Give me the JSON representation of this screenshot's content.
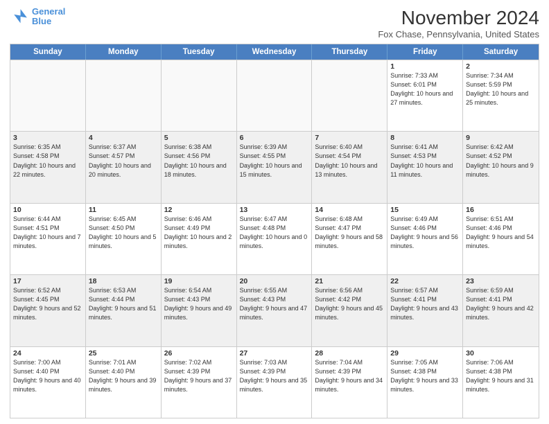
{
  "logo": {
    "line1": "General",
    "line2": "Blue"
  },
  "title": "November 2024",
  "location": "Fox Chase, Pennsylvania, United States",
  "header_days": [
    "Sunday",
    "Monday",
    "Tuesday",
    "Wednesday",
    "Thursday",
    "Friday",
    "Saturday"
  ],
  "rows": [
    [
      {
        "day": "",
        "info": ""
      },
      {
        "day": "",
        "info": ""
      },
      {
        "day": "",
        "info": ""
      },
      {
        "day": "",
        "info": ""
      },
      {
        "day": "",
        "info": ""
      },
      {
        "day": "1",
        "info": "Sunrise: 7:33 AM\nSunset: 6:01 PM\nDaylight: 10 hours and 27 minutes."
      },
      {
        "day": "2",
        "info": "Sunrise: 7:34 AM\nSunset: 5:59 PM\nDaylight: 10 hours and 25 minutes."
      }
    ],
    [
      {
        "day": "3",
        "info": "Sunrise: 6:35 AM\nSunset: 4:58 PM\nDaylight: 10 hours and 22 minutes."
      },
      {
        "day": "4",
        "info": "Sunrise: 6:37 AM\nSunset: 4:57 PM\nDaylight: 10 hours and 20 minutes."
      },
      {
        "day": "5",
        "info": "Sunrise: 6:38 AM\nSunset: 4:56 PM\nDaylight: 10 hours and 18 minutes."
      },
      {
        "day": "6",
        "info": "Sunrise: 6:39 AM\nSunset: 4:55 PM\nDaylight: 10 hours and 15 minutes."
      },
      {
        "day": "7",
        "info": "Sunrise: 6:40 AM\nSunset: 4:54 PM\nDaylight: 10 hours and 13 minutes."
      },
      {
        "day": "8",
        "info": "Sunrise: 6:41 AM\nSunset: 4:53 PM\nDaylight: 10 hours and 11 minutes."
      },
      {
        "day": "9",
        "info": "Sunrise: 6:42 AM\nSunset: 4:52 PM\nDaylight: 10 hours and 9 minutes."
      }
    ],
    [
      {
        "day": "10",
        "info": "Sunrise: 6:44 AM\nSunset: 4:51 PM\nDaylight: 10 hours and 7 minutes."
      },
      {
        "day": "11",
        "info": "Sunrise: 6:45 AM\nSunset: 4:50 PM\nDaylight: 10 hours and 5 minutes."
      },
      {
        "day": "12",
        "info": "Sunrise: 6:46 AM\nSunset: 4:49 PM\nDaylight: 10 hours and 2 minutes."
      },
      {
        "day": "13",
        "info": "Sunrise: 6:47 AM\nSunset: 4:48 PM\nDaylight: 10 hours and 0 minutes."
      },
      {
        "day": "14",
        "info": "Sunrise: 6:48 AM\nSunset: 4:47 PM\nDaylight: 9 hours and 58 minutes."
      },
      {
        "day": "15",
        "info": "Sunrise: 6:49 AM\nSunset: 4:46 PM\nDaylight: 9 hours and 56 minutes."
      },
      {
        "day": "16",
        "info": "Sunrise: 6:51 AM\nSunset: 4:46 PM\nDaylight: 9 hours and 54 minutes."
      }
    ],
    [
      {
        "day": "17",
        "info": "Sunrise: 6:52 AM\nSunset: 4:45 PM\nDaylight: 9 hours and 52 minutes."
      },
      {
        "day": "18",
        "info": "Sunrise: 6:53 AM\nSunset: 4:44 PM\nDaylight: 9 hours and 51 minutes."
      },
      {
        "day": "19",
        "info": "Sunrise: 6:54 AM\nSunset: 4:43 PM\nDaylight: 9 hours and 49 minutes."
      },
      {
        "day": "20",
        "info": "Sunrise: 6:55 AM\nSunset: 4:43 PM\nDaylight: 9 hours and 47 minutes."
      },
      {
        "day": "21",
        "info": "Sunrise: 6:56 AM\nSunset: 4:42 PM\nDaylight: 9 hours and 45 minutes."
      },
      {
        "day": "22",
        "info": "Sunrise: 6:57 AM\nSunset: 4:41 PM\nDaylight: 9 hours and 43 minutes."
      },
      {
        "day": "23",
        "info": "Sunrise: 6:59 AM\nSunset: 4:41 PM\nDaylight: 9 hours and 42 minutes."
      }
    ],
    [
      {
        "day": "24",
        "info": "Sunrise: 7:00 AM\nSunset: 4:40 PM\nDaylight: 9 hours and 40 minutes."
      },
      {
        "day": "25",
        "info": "Sunrise: 7:01 AM\nSunset: 4:40 PM\nDaylight: 9 hours and 39 minutes."
      },
      {
        "day": "26",
        "info": "Sunrise: 7:02 AM\nSunset: 4:39 PM\nDaylight: 9 hours and 37 minutes."
      },
      {
        "day": "27",
        "info": "Sunrise: 7:03 AM\nSunset: 4:39 PM\nDaylight: 9 hours and 35 minutes."
      },
      {
        "day": "28",
        "info": "Sunrise: 7:04 AM\nSunset: 4:39 PM\nDaylight: 9 hours and 34 minutes."
      },
      {
        "day": "29",
        "info": "Sunrise: 7:05 AM\nSunset: 4:38 PM\nDaylight: 9 hours and 33 minutes."
      },
      {
        "day": "30",
        "info": "Sunrise: 7:06 AM\nSunset: 4:38 PM\nDaylight: 9 hours and 31 minutes."
      }
    ]
  ]
}
